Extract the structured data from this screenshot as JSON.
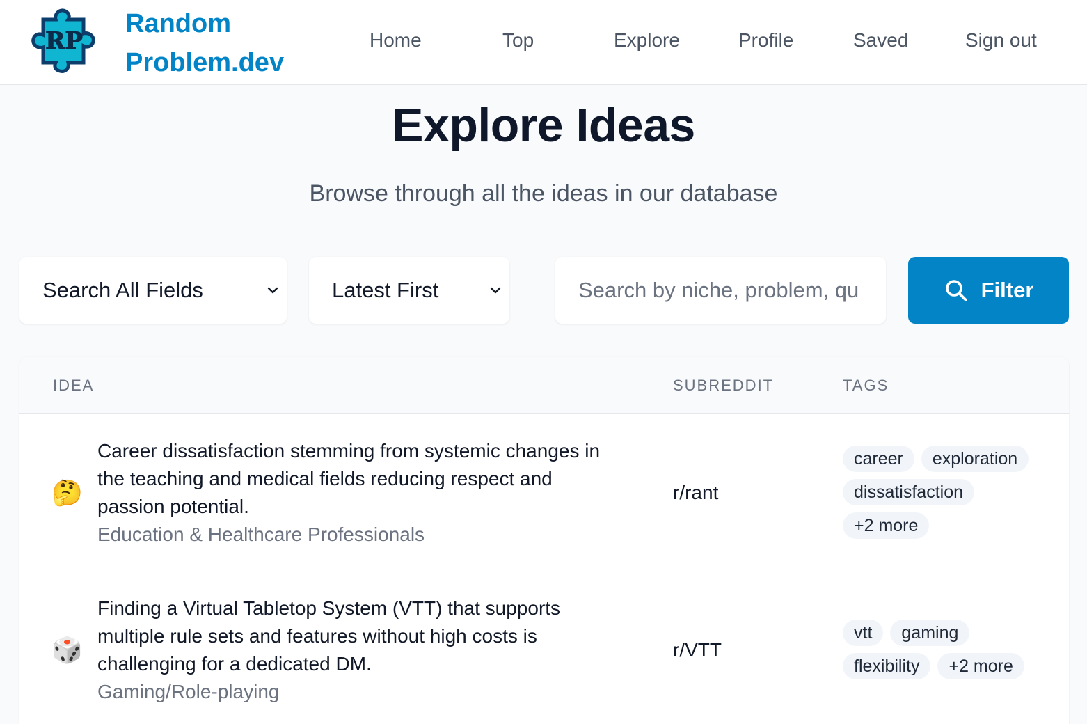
{
  "brand": {
    "line1": "Random",
    "line2": "Problem.dev",
    "logo_text": "RP"
  },
  "nav": [
    "Home",
    "Top",
    "Explore",
    "Profile",
    "Saved",
    "Sign out"
  ],
  "hero": {
    "title": "Explore Ideas",
    "subtitle": "Browse through all the ideas in our database"
  },
  "controls": {
    "field_select": "Search All Fields",
    "sort_select": "Latest First",
    "search_placeholder": "Search by niche, problem, qu",
    "filter_label": "Filter"
  },
  "table": {
    "headers": {
      "idea": "IDEA",
      "subreddit": "SUBREDDIT",
      "tags": "TAGS"
    },
    "rows": [
      {
        "emoji": "🤔",
        "idea": "Career dissatisfaction stemming from systemic changes in the teaching and medical fields reducing respect and passion potential.",
        "niche": "Education & Healthcare Professionals",
        "subreddit": "r/rant",
        "tags": [
          "career",
          "exploration",
          "dissatisfaction",
          "+2 more"
        ]
      },
      {
        "emoji": "🎲",
        "idea": "Finding a Virtual Tabletop System (VTT) that supports multiple rule sets and features without high costs is challenging for a dedicated DM.",
        "niche": "Gaming/Role-playing",
        "subreddit": "r/VTT",
        "tags": [
          "vtt",
          "gaming",
          "flexibility",
          "+2 more"
        ]
      }
    ]
  },
  "colors": {
    "brand": "#0284c7",
    "background": "#f8fafc",
    "tag_bg": "#f1f5f9",
    "muted_text": "#6b7280"
  },
  "icons": {
    "logo": "puzzle-piece-icon",
    "search": "search-icon",
    "chevron": "chevron-down-icon"
  }
}
